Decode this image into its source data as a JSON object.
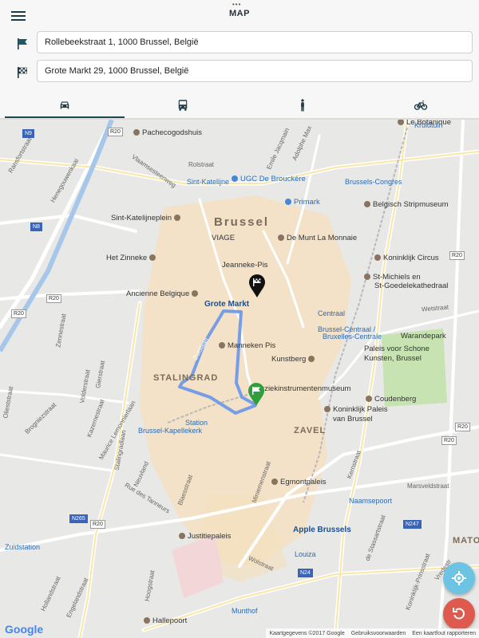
{
  "header": {
    "title": "MAP",
    "status": "•••"
  },
  "route": {
    "origin": "Rollebeekstraat 1, 1000 Brussel, België",
    "destination": "Grote Markt 29, 1000 Brussel, België"
  },
  "modes": [
    {
      "icon": "car-icon",
      "active": true
    },
    {
      "icon": "bus-icon",
      "active": false
    },
    {
      "icon": "walking-icon",
      "active": false
    },
    {
      "icon": "bicycle-icon",
      "active": false
    }
  ],
  "map": {
    "districts": {
      "brussel": "Brussel",
      "stalingrad": "STALINGRAD",
      "zavel": "ZAVEL",
      "matonge": "MATO"
    },
    "pois": {
      "pachecogodshuis": "Pachecogodshuis",
      "le_botanique": "Le Botanique",
      "ugc": "UGC De Brouckère",
      "sint_katelijne": "Sint-Katelijne",
      "primark": "Primark",
      "belgisch_stripmuseum": "Belgisch Stripmuseum",
      "sint_katelijneplein": "Sint-Katelijneplein",
      "viage": "VIAGE",
      "de_munt": "De Munt La Monnaie",
      "het_zinneke": "Het Zinneke",
      "jeanneke_pis": "Jeanneke-Pis",
      "koninklijk_circus": "Koninklijk Circus",
      "ancienne_belgique": "Ancienne Belgique",
      "st_michiels": "St-Michiels en",
      "st_goedele": "St-Goedelekathedraal",
      "grote_markt": "Grote Markt",
      "centraal": "Centraal",
      "warandepark": "Warandepark",
      "brussel_centraal": "Brussel-Centraal /",
      "bruxelles_centrale": "Bruxelles-Centrale",
      "manneken_pis": "Manneken Pis",
      "kunstberg": "Kunstberg",
      "paleis_kunsten_1": "Paleis voor Schone",
      "paleis_kunsten_2": "Kunsten, Brussel",
      "muziekinstrumentenmuseum": "Muziekinstrumentenmuseum",
      "coudenberg": "Coudenberg",
      "koninklijk_paleis_1": "Koninklijk Paleis",
      "koninklijk_paleis_2": "van Brussel",
      "station": "Station",
      "brussel_kapellekerk": "Brussel-Kapellekerk",
      "egmontpaleis": "Egmontpaleis",
      "naamsepoort": "Naamsepoort",
      "apple_brussels": "Apple Brussels",
      "justitiepaleis": "Justitiepaleis",
      "louiza": "Louiza",
      "zuidstation": "Zuidstation",
      "hallepoort": "Hallepoort",
      "munthof": "Munthof",
      "brussels_congres": "Brussels-Congres",
      "kruidtuin": "Kruidtuin",
      "vredestr": "Vredestr"
    },
    "streets": {
      "ransfortstraat": "Ransfortstraat",
      "henegouwenkaai": "Henegouwenkaai",
      "vlaamsesteenweg": "Vlaamsesteenweg",
      "rolstraat": "Rolstraat",
      "emile_jacqmain": "Emile Jacqmain",
      "adolphe_max": "Adolphe Max",
      "zennestraat": "Zennestraat",
      "zuidlaan": "Zuidlaan",
      "gierstraat": "Gierstraat",
      "volderstraat": "Volderstraat",
      "kazernestraat": "Kazernestraat",
      "maurice_lemonnier": "Maurice Lemonnierlaan",
      "stalingradlaan": "Stalingradlaan",
      "rue_des_tanneurs": "Rue des Tanneurs",
      "blaesstraat": "Blaesstraat",
      "miniemenstraat": "Miniemenstraat",
      "marsveldstraat": "Marsveldstraat",
      "kernstraat": "Kernstraat",
      "wolstraat": "Wolstraat",
      "hoogstraat": "Hoogstraat",
      "hollandstraat": "Hollandstraat",
      "engelandstraat": "Engelandstraat",
      "wetstraat": "Wetstraat",
      "olieststraat": "Olieststraat",
      "brogniezstraat": "Brogniezstraat",
      "neuvland": "Neuvland",
      "de_stassartstraat": "de Stassartstraat",
      "koninklijk_prinsstraat": "Koninklijk-Prinsstraat"
    },
    "shields": {
      "n9": "N9",
      "n8": "N8",
      "r20": "R20",
      "n265": "N265",
      "n24": "N24",
      "n247": "N247"
    },
    "attribution": {
      "mapdata": "Kaartgegevens ©2017 Google",
      "terms": "Gebruiksvoorwaarden",
      "report": "Een kaartfout rapporteren"
    },
    "google": "Google"
  },
  "colors": {
    "route": "#6f99e8",
    "start_pin": "#2e9e3f",
    "end_pin": "#111111",
    "locate_fab": "#6cc3e3",
    "reset_fab": "#df5a4e",
    "header_accent": "#1b4a55"
  }
}
